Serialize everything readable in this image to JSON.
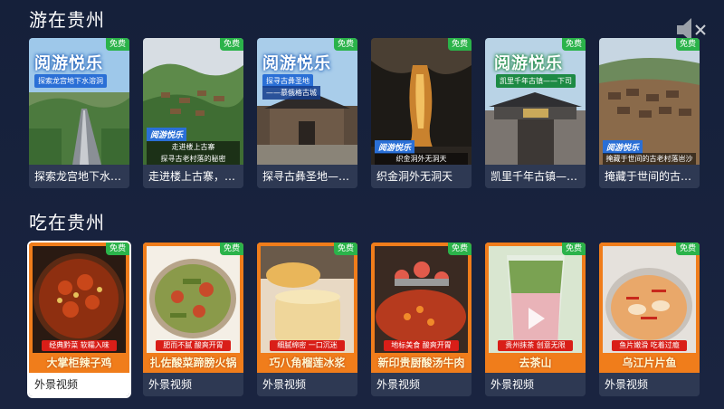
{
  "sections": {
    "travel": {
      "title": "游在贵州",
      "cards": [
        {
          "free": "免费",
          "poster_title": "阅游悦乐",
          "poster_sub": "探索龙宫地下水溶洞",
          "caption": "探索龙宫地下水溶..."
        },
        {
          "free": "免费",
          "poster_tag": "阅游悦乐",
          "poster_tag_sub": "走进楼上古寨",
          "poster_tag_sub2": "探寻古老村落的秘密",
          "caption": "走进楼上古寨，探..."
        },
        {
          "free": "免费",
          "poster_title": "阅游悦乐",
          "poster_sub": "探寻古彝圣地",
          "poster_sub2": "——慕俄格古城",
          "caption": "探寻古彝圣地——..."
        },
        {
          "free": "免费",
          "poster_tag": "阅游悦乐",
          "poster_tag_sub": "织金洞外无洞天",
          "caption": "织金洞外无洞天"
        },
        {
          "free": "免费",
          "poster_title": "阅游悦乐",
          "poster_sub": "凯里千年古镇——下司",
          "caption": "凯里千年古镇——..."
        },
        {
          "free": "免费",
          "poster_tag": "阅游悦乐",
          "poster_tag_sub": "掩藏于世间的古老村落岜沙",
          "caption": "掩藏于世间的古老..."
        }
      ]
    },
    "food": {
      "title": "吃在贵州",
      "cards": [
        {
          "free": "免费",
          "tagline": "经典黔菜  软糯入味",
          "name": "大掌柜辣子鸡",
          "caption": "外景视频"
        },
        {
          "free": "免费",
          "tagline": "肥而不腻  酸爽开胃",
          "name": "扎佐酸菜蹄膀火锅",
          "caption": "外景视频"
        },
        {
          "free": "免费",
          "tagline": "细腻绵密  一口沉迷",
          "name": "巧八角榴莲冰浆",
          "caption": "外景视频"
        },
        {
          "free": "免费",
          "tagline": "地标美食  酸爽开胃",
          "name": "新印贵厨酸汤牛肉",
          "caption": "外景视频"
        },
        {
          "free": "免费",
          "tagline": "贵州抹茶  创意无限",
          "name": "去茶山",
          "caption": "外景视频"
        },
        {
          "free": "免费",
          "tagline": "鱼片嫩滑  吃着过瘾",
          "name": "乌江片片鱼",
          "caption": "外景视频"
        }
      ]
    }
  },
  "colors": {
    "accent_orange": "#f07d1b",
    "free_green": "#2bb34a",
    "poster_blue": "#2a6fd6"
  }
}
